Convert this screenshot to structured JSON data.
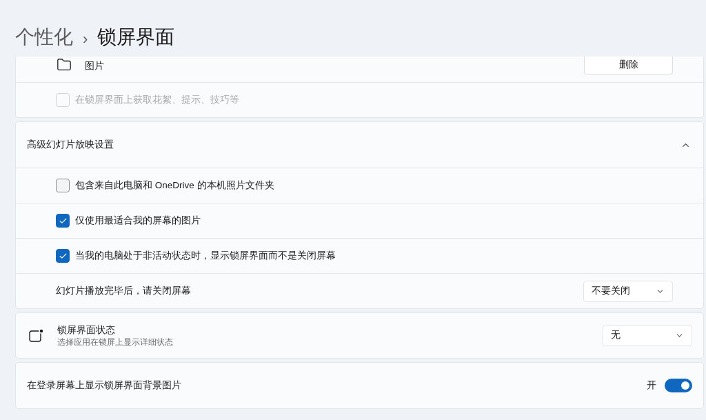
{
  "breadcrumb": {
    "parent": "个性化",
    "separator": "›",
    "current": "锁屏界面"
  },
  "photos_card": {
    "folder": {
      "label": "图片",
      "button": "删除"
    },
    "tips": {
      "label": "在锁屏界面上获取花絮、提示、技巧等",
      "checked": false,
      "disabled": true
    }
  },
  "slideshow": {
    "title": "高级幻灯片放映设置",
    "expanded": true,
    "options": [
      {
        "kind": "checkbox",
        "label": "包含来自此电脑和 OneDrive 的本机照片文件夹",
        "checked": false,
        "disabled": false
      },
      {
        "kind": "checkbox",
        "label": "仅使用最适合我的屏幕的图片",
        "checked": true,
        "disabled": false
      },
      {
        "kind": "checkbox",
        "label": "当我的电脑处于非活动状态时，显示锁屏界面而不是关闭屏幕",
        "checked": true,
        "disabled": false
      },
      {
        "kind": "dropdown",
        "label": "幻灯片播放完毕后，请关闭屏幕",
        "value": "不要关闭"
      }
    ]
  },
  "status": {
    "title": "锁屏界面状态",
    "description": "选择应用在锁屏上显示详细状态",
    "value": "无"
  },
  "signin_background": {
    "label": "在登录屏幕上显示锁屏界面背景图片",
    "on": true,
    "state_label": "开"
  }
}
